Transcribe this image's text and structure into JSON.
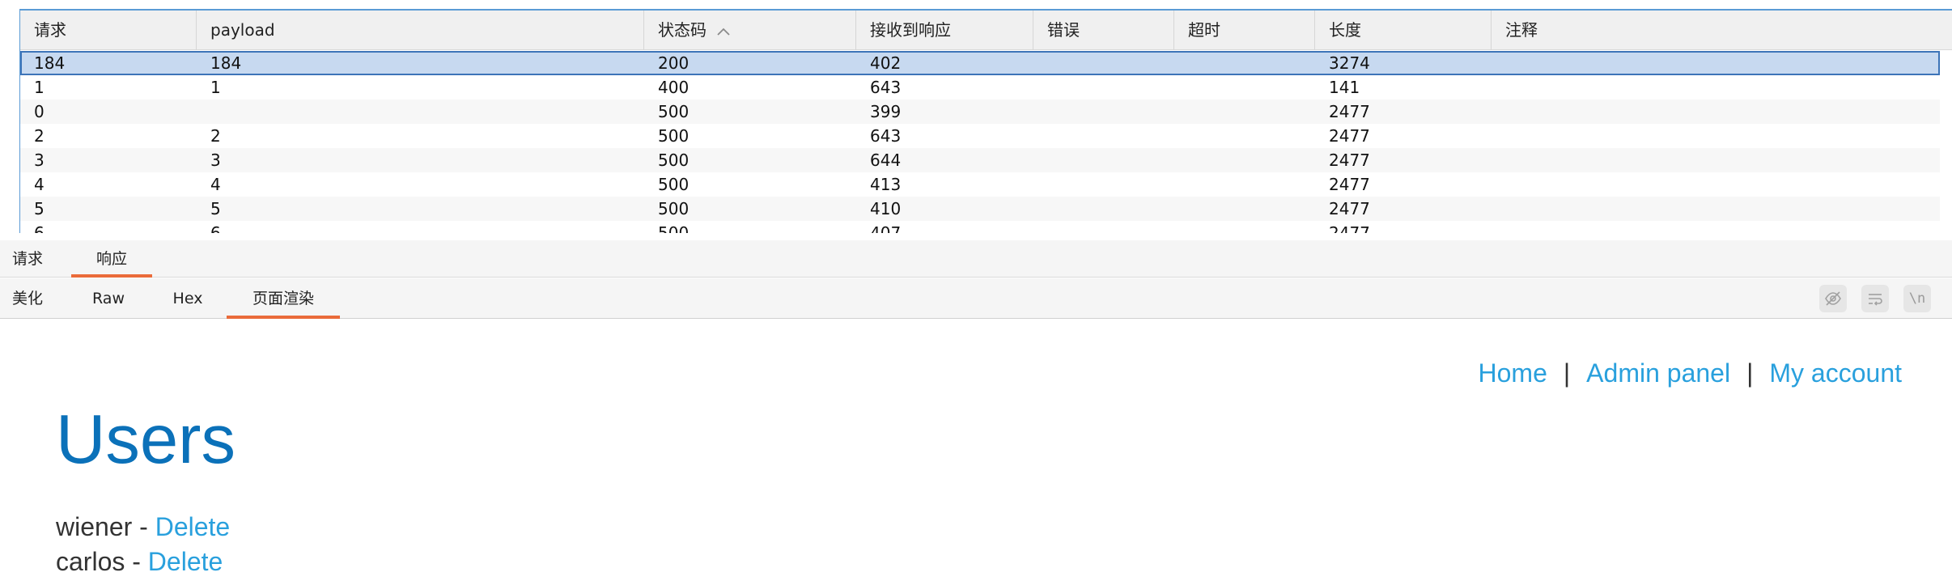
{
  "table": {
    "columns": [
      {
        "key": "request",
        "label": "请求"
      },
      {
        "key": "payload",
        "label": "payload"
      },
      {
        "key": "status",
        "label": "状态码",
        "sorted": "ascending"
      },
      {
        "key": "response_received",
        "label": "接收到响应"
      },
      {
        "key": "error",
        "label": "错误"
      },
      {
        "key": "timeout",
        "label": "超时"
      },
      {
        "key": "length",
        "label": "长度"
      },
      {
        "key": "comment",
        "label": "注释"
      }
    ],
    "rows": [
      {
        "request": "184",
        "payload": "184",
        "status": "200",
        "response_received": "402",
        "error": "",
        "timeout": "",
        "length": "3274",
        "comment": "",
        "selected": true
      },
      {
        "request": "1",
        "payload": "1",
        "status": "400",
        "response_received": "643",
        "error": "",
        "timeout": "",
        "length": "141",
        "comment": ""
      },
      {
        "request": "0",
        "payload": "",
        "status": "500",
        "response_received": "399",
        "error": "",
        "timeout": "",
        "length": "2477",
        "comment": ""
      },
      {
        "request": "2",
        "payload": "2",
        "status": "500",
        "response_received": "643",
        "error": "",
        "timeout": "",
        "length": "2477",
        "comment": ""
      },
      {
        "request": "3",
        "payload": "3",
        "status": "500",
        "response_received": "644",
        "error": "",
        "timeout": "",
        "length": "2477",
        "comment": ""
      },
      {
        "request": "4",
        "payload": "4",
        "status": "500",
        "response_received": "413",
        "error": "",
        "timeout": "",
        "length": "2477",
        "comment": ""
      },
      {
        "request": "5",
        "payload": "5",
        "status": "500",
        "response_received": "410",
        "error": "",
        "timeout": "",
        "length": "2477",
        "comment": ""
      },
      {
        "request": "6",
        "payload": "6",
        "status": "500",
        "response_received": "407",
        "error": "",
        "timeout": "",
        "length": "2477",
        "comment": ""
      }
    ]
  },
  "main_tabs": {
    "request": "请求",
    "response": "响应",
    "active": "response"
  },
  "view_tabs": {
    "pretty": "美化",
    "raw": "Raw",
    "hex": "Hex",
    "render": "页面渲染",
    "active": "render"
  },
  "toolbar": {
    "icons": [
      "eye-off-icon",
      "wrap-lines-icon",
      "newline-icon"
    ],
    "newline_glyph": "\\n"
  },
  "rendered_page": {
    "nav": {
      "home": "Home",
      "admin_panel": "Admin panel",
      "my_account": "My account",
      "separator": "|"
    },
    "title": "Users",
    "users": [
      {
        "name": "wiener",
        "dash": " - ",
        "action": "Delete"
      },
      {
        "name": "carlos",
        "dash": " - ",
        "action": "Delete"
      }
    ]
  },
  "colors": {
    "accent_tab": "#ea6b3a",
    "selection_bg": "#c7d9f0",
    "selection_border": "#3d74b8",
    "link": "#29a0dd",
    "heading": "#0b71b9"
  }
}
